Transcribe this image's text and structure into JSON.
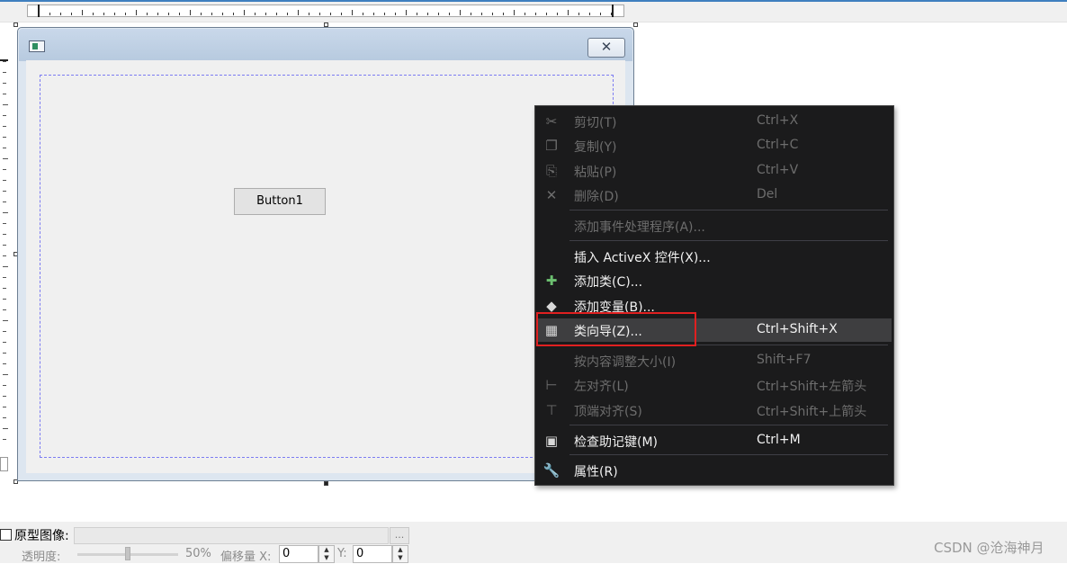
{
  "dialog": {
    "close_glyph": "✕",
    "button_label": "Button1"
  },
  "context_menu": {
    "items": [
      {
        "label": "剪切(T)",
        "shortcut": "Ctrl+X",
        "icon": "scissors-icon",
        "enabled": false
      },
      {
        "label": "复制(Y)",
        "shortcut": "Ctrl+C",
        "icon": "copy-icon",
        "enabled": false
      },
      {
        "label": "粘贴(P)",
        "shortcut": "Ctrl+V",
        "icon": "paste-icon",
        "enabled": false
      },
      {
        "label": "删除(D)",
        "shortcut": "Del",
        "icon": "delete-x-icon",
        "enabled": false
      },
      {
        "label": "添加事件处理程序(A)...",
        "shortcut": "",
        "icon": "",
        "enabled": false
      },
      {
        "label": "插入 ActiveX 控件(X)...",
        "shortcut": "",
        "icon": "",
        "enabled": true
      },
      {
        "label": "添加类(C)...",
        "shortcut": "",
        "icon": "add-class-icon",
        "enabled": true
      },
      {
        "label": "添加变量(B)...",
        "shortcut": "",
        "icon": "add-variable-icon",
        "enabled": true
      },
      {
        "label": "类向导(Z)...",
        "shortcut": "Ctrl+Shift+X",
        "icon": "class-wizard-icon",
        "enabled": true,
        "highlighted": true
      },
      {
        "label": "按内容调整大小(I)",
        "shortcut": "Shift+F7",
        "icon": "",
        "enabled": false
      },
      {
        "label": "左对齐(L)",
        "shortcut": "Ctrl+Shift+左箭头",
        "icon": "align-left-icon",
        "enabled": false
      },
      {
        "label": "顶端对齐(S)",
        "shortcut": "Ctrl+Shift+上箭头",
        "icon": "align-top-icon",
        "enabled": false
      },
      {
        "label": "检查助记键(M)",
        "shortcut": "Ctrl+M",
        "icon": "check-mnemonics-icon",
        "enabled": true
      },
      {
        "label": "属性(R)",
        "shortcut": "",
        "icon": "wrench-icon",
        "enabled": true
      }
    ]
  },
  "bottom_panel": {
    "prototype_label": "原型图像:",
    "browse_label": "...",
    "opacity_label": "透明度:",
    "opacity_value": "50%",
    "opacity_fraction": 0.5,
    "offset_label": "偏移量 X:",
    "x_value": "0",
    "y_label": "Y:",
    "y_value": "0"
  },
  "watermark": "CSDN @沧海神月",
  "colors": {
    "menu_bg": "#1b1b1c",
    "menu_highlight": "#3e3e40",
    "highlight_box": "#e02020",
    "dialog_title": "#c9d8ea"
  }
}
